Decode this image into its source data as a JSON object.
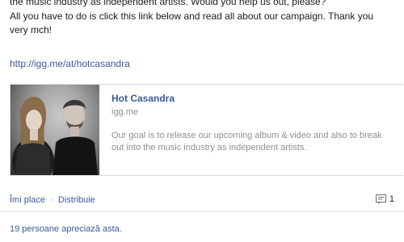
{
  "post": {
    "line1": "the music industry as independent artists. Would you help us out, please?",
    "line2": "All you have to do is click this link below and read all about our campaign. Thank you",
    "line3": "very mch!",
    "link": "http://igg.me/at/hotcasandra"
  },
  "share_card": {
    "title": "Hot Casandra",
    "domain": "igg.me",
    "description": "Our goal is to release our upcoming album & video and also to break out into the music industry as independent artists.",
    "thumbnail_icon": "band-photo"
  },
  "actions": {
    "like_label": "Îmi place",
    "separator": "·",
    "share_label": "Distribuie",
    "comment_icon": "comment-icon",
    "comment_count": "1"
  },
  "likes": {
    "text": "19 persoane apreciază asta."
  },
  "colors": {
    "link": "#3b5998",
    "muted": "#8b8f96",
    "border": "#d3d6db"
  }
}
